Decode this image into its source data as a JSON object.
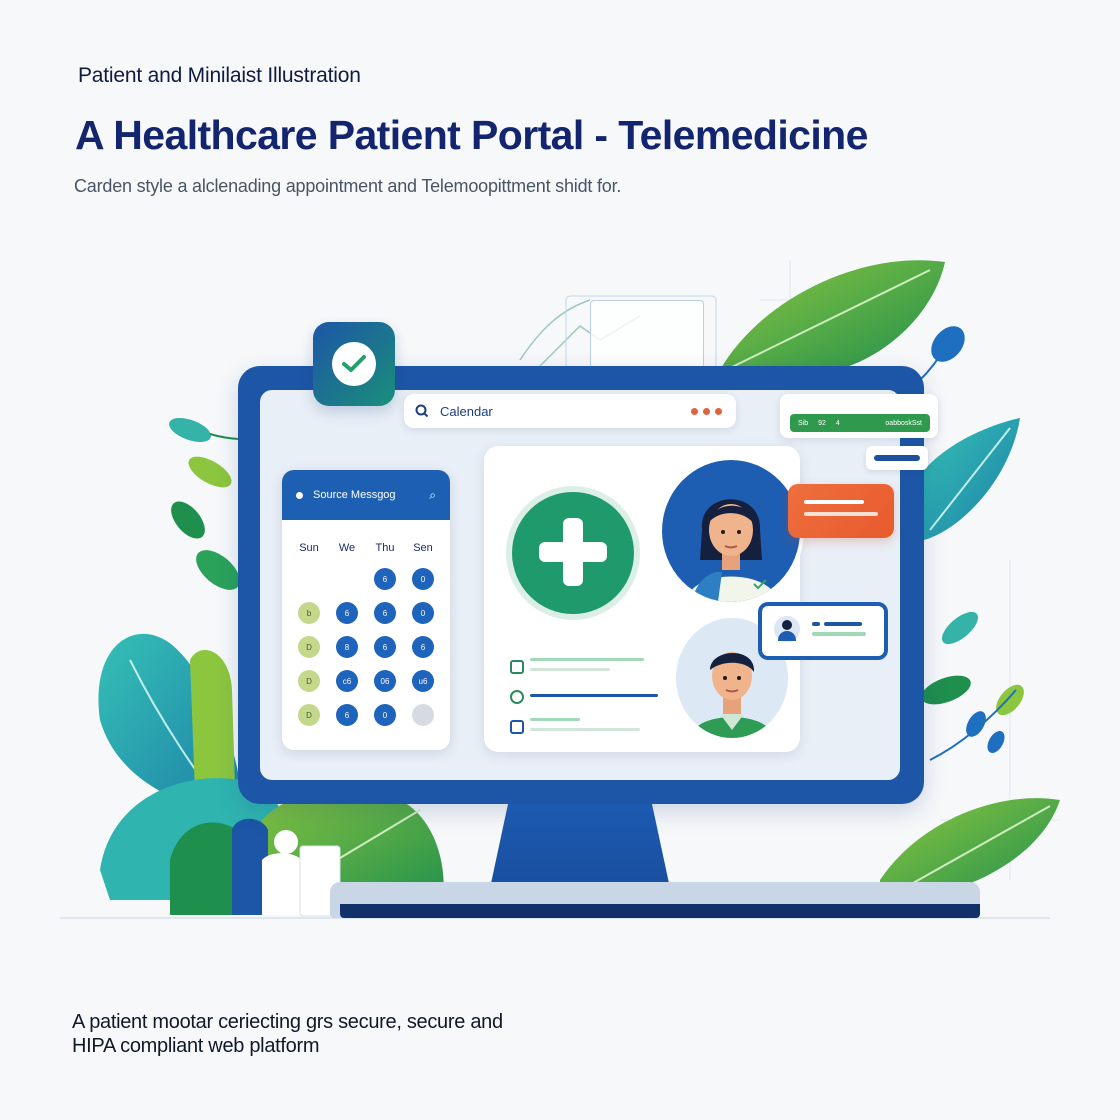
{
  "eyebrow": "Patient and Minilaist Illustration",
  "title": "A Healthcare Patient Portal - Telemedicine",
  "subtitle": "Carden style a alclenading appointment and Telemoopittment shidt for.",
  "caption": {
    "line1": "A patient mootar ceriecting grs secure, secure and",
    "line2": "HIPA compliant web platform"
  },
  "search": {
    "label": "Calendar",
    "icon": "search-icon"
  },
  "calendar": {
    "header": "Source Messgog",
    "days": [
      "Sun",
      "We",
      "Thu",
      "Sen"
    ],
    "rows": [
      [
        {
          "t": "",
          "c": "empty"
        },
        {
          "t": "",
          "c": "empty"
        },
        {
          "t": "6",
          "c": "blue"
        },
        {
          "t": "0",
          "c": "blue"
        }
      ],
      [
        {
          "t": "b",
          "c": "green"
        },
        {
          "t": "6",
          "c": "blue"
        },
        {
          "t": "6",
          "c": "blue"
        },
        {
          "t": "0",
          "c": "blue"
        }
      ],
      [
        {
          "t": "D",
          "c": "green"
        },
        {
          "t": "8",
          "c": "blue"
        },
        {
          "t": "6",
          "c": "blue"
        },
        {
          "t": "6",
          "c": "blue"
        }
      ],
      [
        {
          "t": "D",
          "c": "green"
        },
        {
          "t": "c6",
          "c": "blue"
        },
        {
          "t": "06",
          "c": "blue"
        },
        {
          "t": "u6",
          "c": "blue"
        }
      ],
      [
        {
          "t": "D",
          "c": "green"
        },
        {
          "t": "6",
          "c": "blue"
        },
        {
          "t": "0",
          "c": "blue"
        },
        {
          "t": "",
          "c": "grey"
        }
      ]
    ]
  },
  "top_right_widget": {
    "left": "Sib",
    "mid1": "92",
    "mid2": "4",
    "right": "oabboskSst"
  },
  "colors": {
    "primary": "#1d56a6",
    "accent_green": "#1f9a6c",
    "accent_orange": "#ec6a39",
    "leaf_green": "#2f9a4e",
    "leaf_teal": "#1fa5a0"
  }
}
